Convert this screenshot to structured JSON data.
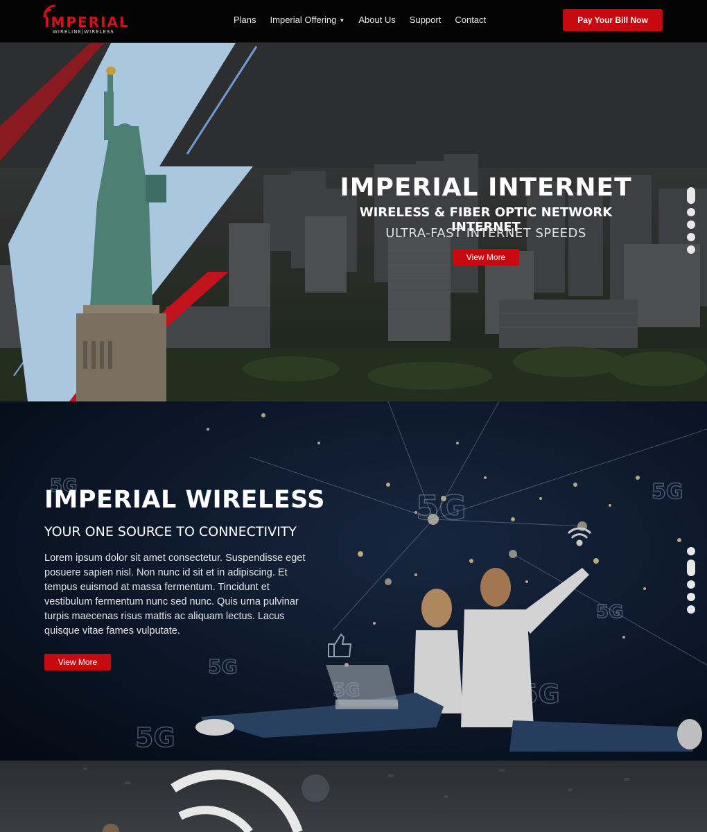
{
  "header": {
    "logo_word": "IMPERIAL",
    "logo_sub": "WIRELINE|WIRELESS",
    "nav": [
      {
        "label": "Plans"
      },
      {
        "label": "Imperial Offering",
        "has_dropdown": true
      },
      {
        "label": "About Us"
      },
      {
        "label": "Support"
      },
      {
        "label": "Contact"
      }
    ],
    "cta_label": "Pay Your Bill Now"
  },
  "hero1": {
    "title": "IMPERIAL INTERNET",
    "subtitle": "WIRELESS & FIBER OPTIC NETWORK INTERNET",
    "tagline": "ULTRA-FAST INTERNET SPEEDS",
    "button_label": "View More",
    "slider_count": 5,
    "active_slide": 1
  },
  "hero2": {
    "title": "IMPERIAL WIRELESS",
    "subtitle": "YOUR ONE SOURCE TO CONNECTIVITY",
    "body": "Lorem ipsum dolor sit amet consectetur. Suspendisse eget posuere sapien nisl. Non nunc id sit et in adipiscing. Et tempus euismod at massa fermentum. Tincidunt et vestibulum fermentum nunc sed nunc. Quis urna pulvinar turpis maecenas risus mattis ac aliquam lectus. Lacus quisque vitae fames vulputate.",
    "button_label": "View More",
    "badge_text": "5G",
    "slider_count": 5,
    "active_slide": 2
  },
  "colors": {
    "brand_red": "#c8090f",
    "header_bg": "#040404",
    "navy": "#0e1a2e"
  },
  "icons": [
    "signal-icon",
    "chevron-down-icon",
    "wifi-icon",
    "thumbs-up-icon",
    "statue-of-liberty-image",
    "couple-image"
  ]
}
